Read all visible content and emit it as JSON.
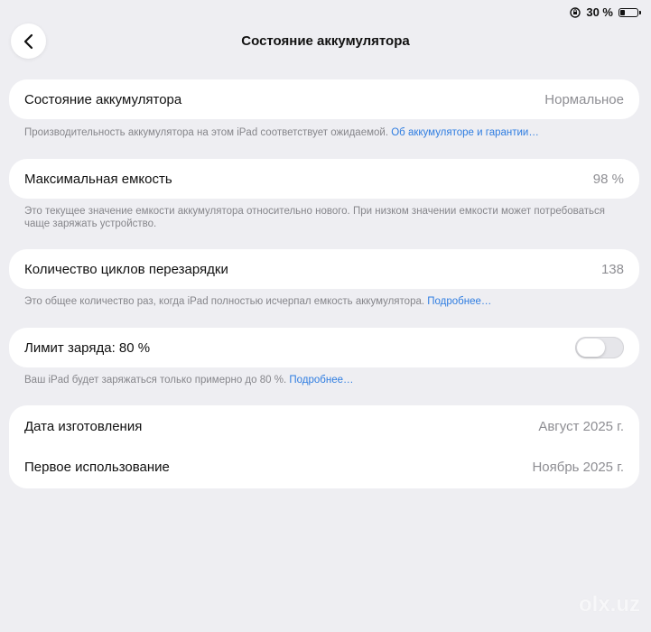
{
  "status_bar": {
    "battery_percent_text": "30 %",
    "battery_level": 0.3
  },
  "header": {
    "title": "Состояние аккумулятора",
    "back_icon": "chevron-left-icon"
  },
  "battery_health": {
    "label": "Состояние аккумулятора",
    "value": "Нормальное",
    "footnote": "Производительность аккумулятора на этом iPad соответствует ожидаемой.",
    "footnote_link": "Об аккумуляторе и гарантии…"
  },
  "max_capacity": {
    "label": "Максимальная емкость",
    "value": "98 %",
    "footnote": "Это текущее значение емкости аккумулятора относительно нового. При низком значении емкости может потребоваться чаще заряжать устройство."
  },
  "cycle_count": {
    "label": "Количество циклов перезарядки",
    "value": "138",
    "footnote": "Это общее количество раз, когда iPad полностью исчерпал емкость аккумулятора.",
    "footnote_link": "Подробнее…"
  },
  "charge_limit": {
    "label": "Лимит заряда: 80 %",
    "toggle_on": false,
    "footnote": "Ваш iPad будет заряжаться только примерно до 80 %.",
    "footnote_link": "Подробнее…"
  },
  "dates": {
    "manufacture_label": "Дата изготовления",
    "manufacture_value": "Август 2025 г.",
    "first_use_label": "Первое использование",
    "first_use_value": "Ноябрь 2025 г."
  },
  "watermark": {
    "text": "olx.uz"
  }
}
